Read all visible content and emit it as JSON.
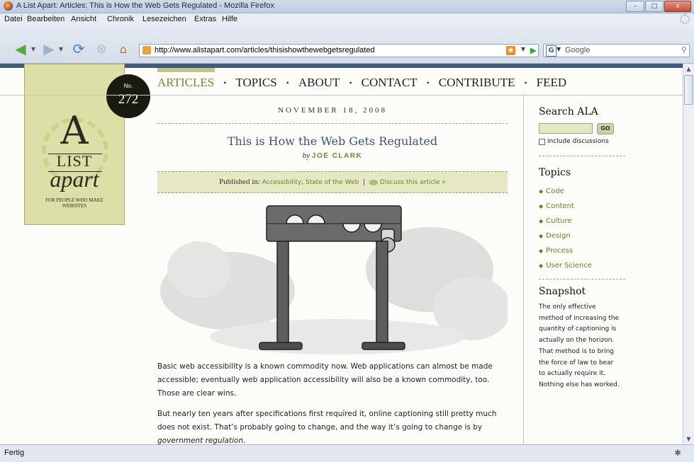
{
  "window": {
    "title": "A List Apart: Articles: This is How the Web Gets Regulated - Mozilla Firefox",
    "min_label": "–",
    "max_label": "□",
    "close_label": "x"
  },
  "menu": [
    "Datei",
    "Bearbeiten",
    "Ansicht",
    "Chronik",
    "Lesezeichen",
    "Extras",
    "Hilfe"
  ],
  "toolbar": {
    "url": "http://www.alistapart.com/articles/thisishowthewebgetsregulated",
    "search_placeholder": "Google"
  },
  "logo": {
    "big_letter": "A",
    "list": "LIST",
    "apart": "apart",
    "tagline": "FOR PEOPLE WHO MAKE WEBSITES",
    "issue_no_label": "No.",
    "issue_number": "272"
  },
  "nav": [
    "ARTICLES",
    "TOPICS",
    "ABOUT",
    "CONTACT",
    "CONTRIBUTE",
    "FEED"
  ],
  "article": {
    "date": "NOVEMBER 18, 2008",
    "title": "This is How the Web Gets Regulated",
    "by": "by",
    "author": "JOE CLARK",
    "published_label": "Published in:",
    "category1": "Accessibility",
    "category2": "State of the Web",
    "separator": "|",
    "discuss": "Discuss this article »",
    "para1": "Basic web accessibility is a known commodity now. Web applications can almost be made accessible; eventually web application accessibility will also be a known commodity, too. Those are clear wins.",
    "para2_start": "But nearly ten years after specifications first required it, online captioning still pretty much does not exist. That’s probably going to change, and the way it’s going to change is by ",
    "para2_em": "government regulation",
    "para2_end": "."
  },
  "sidebar": {
    "search_heading": "Search ALA",
    "go_label": "GO",
    "include_label": "include discussions",
    "topics_heading": "Topics",
    "topics": [
      "Code",
      "Content",
      "Culture",
      "Design",
      "Process",
      "User Science"
    ],
    "snapshot_heading": "Snapshot",
    "snapshot_text": "The only effective method of increasing the quantity of captioning is actually on the horizon. That method is to bring the force of law to bear to actually require it. Nothing else has worked."
  },
  "status": {
    "text": "Fertig"
  },
  "colors": {
    "accent_green": "#6d8c33",
    "logo_bg": "#dcdfa6",
    "title_blue": "#3d5570",
    "header_stripe": "#405a79"
  }
}
